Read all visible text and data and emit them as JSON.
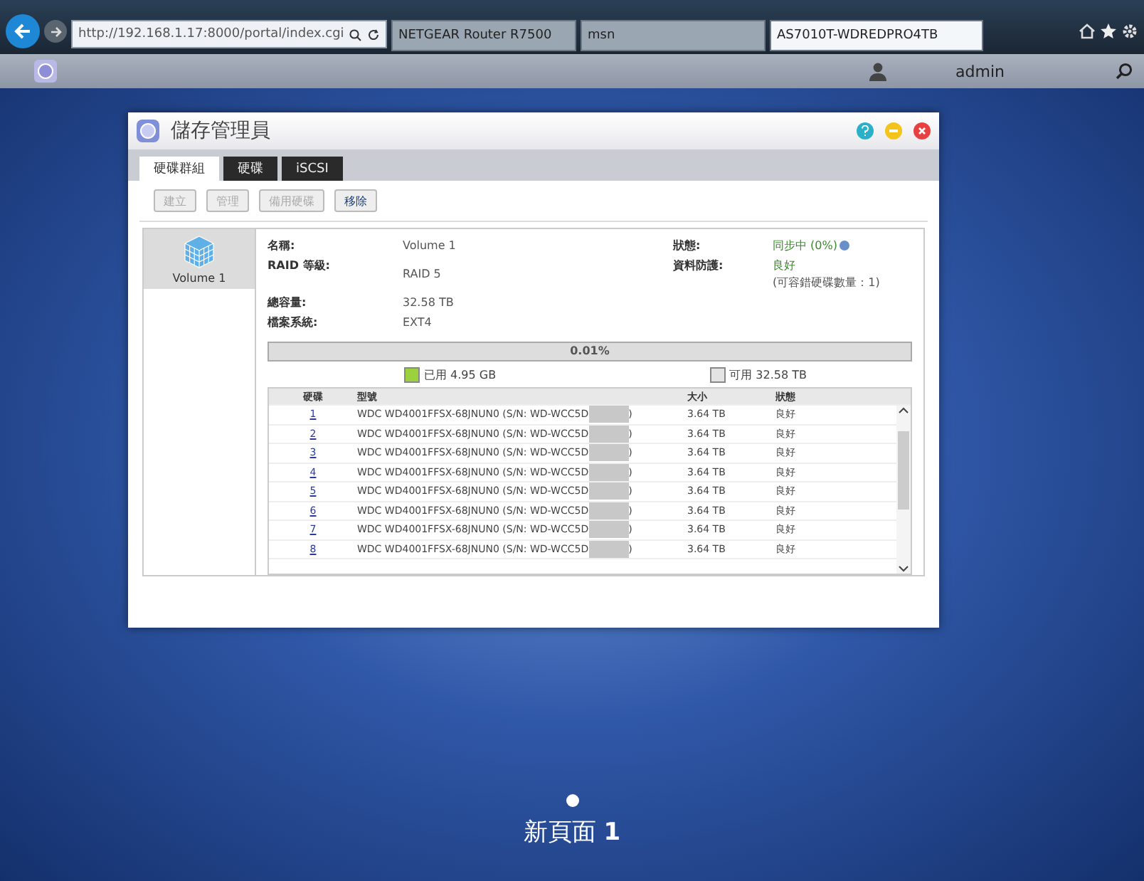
{
  "browser": {
    "address": "http://192.168.1.17:8000/portal/index.cgi",
    "tabs": [
      {
        "title": "NETGEAR Router R7500",
        "selected": false
      },
      {
        "title": "msn",
        "selected": false
      },
      {
        "title": "AS7010T-WDREDPRO4TB",
        "selected": true
      }
    ]
  },
  "portal_bar": {
    "user": "admin"
  },
  "dialog": {
    "title": "儲存管理員",
    "tabs": [
      {
        "label": "硬碟群組",
        "selected": true
      },
      {
        "label": "硬碟",
        "selected": false
      },
      {
        "label": "iSCSI",
        "selected": false
      }
    ],
    "buttons": [
      {
        "label": "建立",
        "disabled": true
      },
      {
        "label": "管理",
        "disabled": true
      },
      {
        "label": "備用硬碟",
        "disabled": true
      },
      {
        "label": "移除",
        "disabled": false
      }
    ],
    "volumes": [
      {
        "label": "Volume 1",
        "selected": true
      }
    ],
    "info_left": [
      {
        "label": "名稱:",
        "value": "Volume 1"
      },
      {
        "label": "RAID 等級:",
        "value": "RAID 5"
      },
      {
        "label": "總容量:",
        "value": "32.58 TB"
      },
      {
        "label": "檔案系統:",
        "value": "EXT4"
      }
    ],
    "info_right": [
      {
        "label": "狀態:",
        "value": "同步中 (0%)"
      },
      {
        "label": "資料防護:",
        "value": "良好",
        "note": "(可容錯硬碟數量：1)"
      }
    ],
    "usage": {
      "percent": "0.01%",
      "level": 0.0001,
      "used": "已用 4.95 GB",
      "free": "可用 32.58 TB"
    },
    "disks": {
      "columns": [
        "硬碟",
        "型號",
        "大小",
        "狀態"
      ],
      "rows": [
        {
          "index": "1",
          "model": "WDC WD4001FFSX-68JNUN0 (S/N: WD-WCC5D",
          "model_end": ")",
          "size": "3.64 TB",
          "status": "良好"
        },
        {
          "index": "2",
          "model": "WDC WD4001FFSX-68JNUN0 (S/N: WD-WCC5D",
          "model_end": ")",
          "size": "3.64 TB",
          "status": "良好"
        },
        {
          "index": "3",
          "model": "WDC WD4001FFSX-68JNUN0 (S/N: WD-WCC5D",
          "model_end": ")",
          "size": "3.64 TB",
          "status": "良好"
        },
        {
          "index": "4",
          "model": "WDC WD4001FFSX-68JNUN0 (S/N: WD-WCC5D",
          "model_end": ")",
          "size": "3.64 TB",
          "status": "良好"
        },
        {
          "index": "5",
          "model": "WDC WD4001FFSX-68JNUN0 (S/N: WD-WCC5D",
          "model_end": ")",
          "size": "3.64 TB",
          "status": "良好"
        },
        {
          "index": "6",
          "model": "WDC WD4001FFSX-68JNUN0 (S/N: WD-WCC5D",
          "model_end": ")",
          "size": "3.64 TB",
          "status": "良好"
        },
        {
          "index": "7",
          "model": "WDC WD4001FFSX-68JNUN0 (S/N: WD-WCC5D",
          "model_end": ")",
          "size": "3.64 TB",
          "status": "良好"
        },
        {
          "index": "8",
          "model": "WDC WD4001FFSX-68JNUN0 (S/N: WD-WCC5D",
          "model_end": ")",
          "size": "3.64 TB",
          "status": "良好"
        }
      ]
    }
  },
  "page_indicator": {
    "label": "新頁面 **1**"
  }
}
